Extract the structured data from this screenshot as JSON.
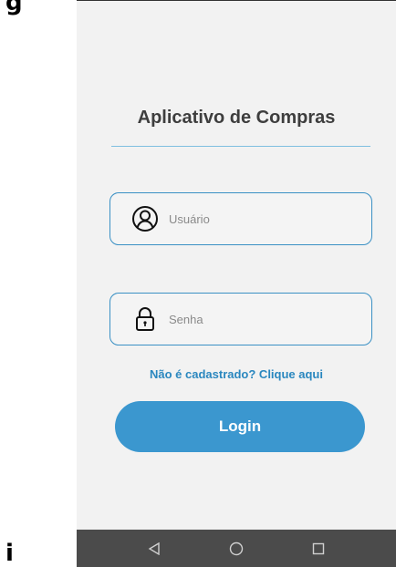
{
  "app": {
    "title": "Aplicativo de Compras"
  },
  "login_form": {
    "username_placeholder": "Usuário",
    "password_placeholder": "Senha",
    "register_link": "Não é cadastrado? Clique aqui",
    "login_button": "Login"
  },
  "nav_bar": {
    "buttons": [
      "back-icon",
      "home-icon",
      "recents-icon"
    ]
  },
  "corner_labels": {
    "top": "g",
    "bottom": "i"
  },
  "colors": {
    "accent": "#3b97cf",
    "link": "#2a87bf",
    "field_border": "#3a90c4",
    "background": "#f2f2f2",
    "nav_bar": "#4b4b4b"
  }
}
